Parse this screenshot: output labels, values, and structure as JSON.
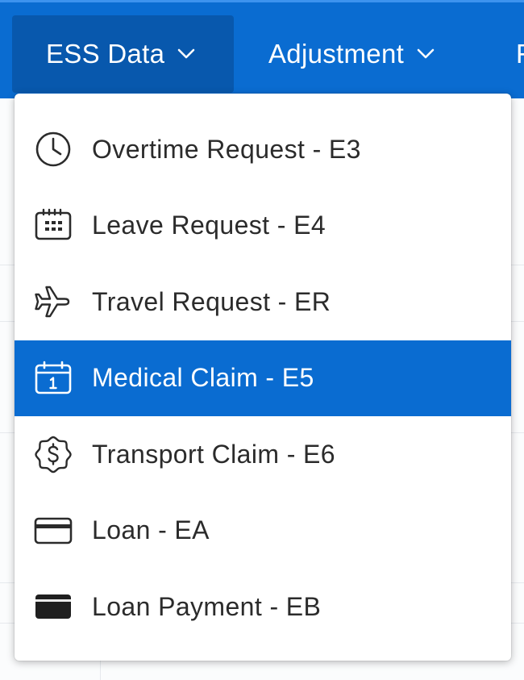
{
  "navbar": {
    "items": [
      {
        "label": "ESS Data",
        "active": true
      },
      {
        "label": "Adjustment",
        "active": false
      },
      {
        "label": "F",
        "active": false
      }
    ],
    "background": "#0a6cd1",
    "active_background": "#0858ad"
  },
  "dropdown": {
    "items": [
      {
        "label": "Overtime Request - E3",
        "icon": "clock-icon",
        "selected": false
      },
      {
        "label": "Leave Request - E4",
        "icon": "calendar-grid-icon",
        "selected": false
      },
      {
        "label": "Travel Request - ER",
        "icon": "airplane-icon",
        "selected": false
      },
      {
        "label": "Medical Claim - E5",
        "icon": "calendar-day-icon",
        "selected": true
      },
      {
        "label": "Transport Claim - E6",
        "icon": "dollar-badge-icon",
        "selected": false
      },
      {
        "label": "Loan - EA",
        "icon": "credit-card-outline-icon",
        "selected": false
      },
      {
        "label": "Loan Payment - EB",
        "icon": "credit-card-filled-icon",
        "selected": false
      }
    ],
    "selected_color": "#0a6cd1"
  }
}
